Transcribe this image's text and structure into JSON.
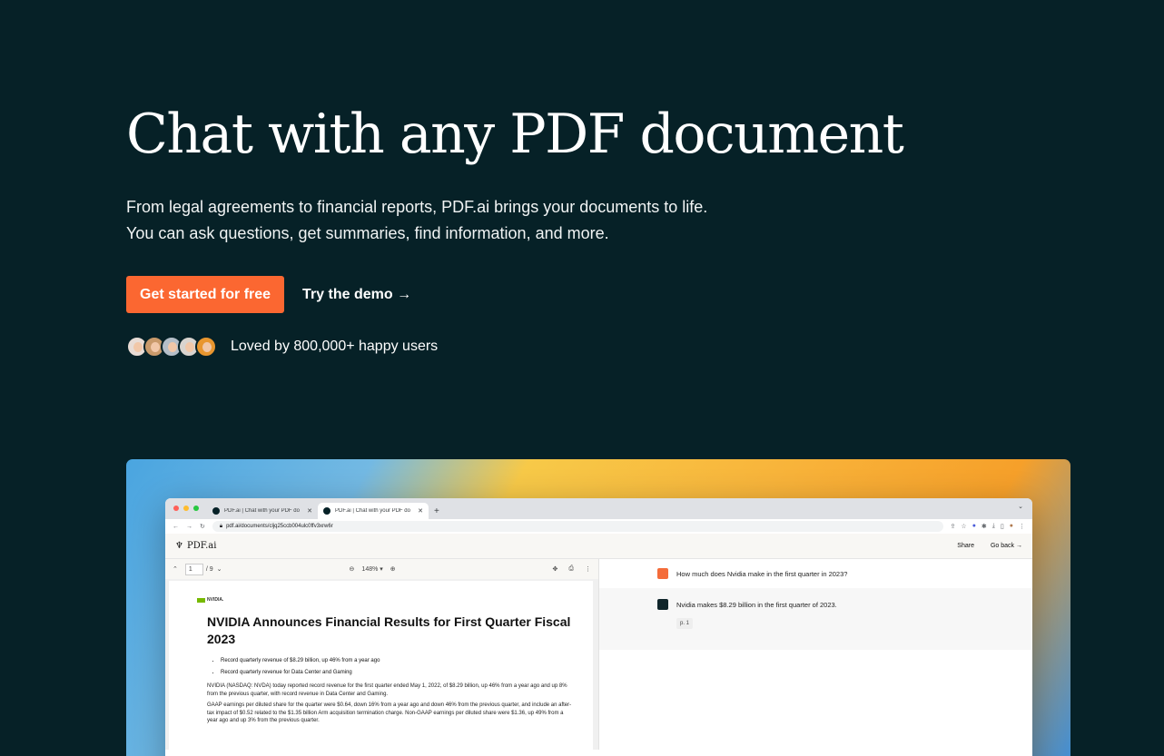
{
  "hero": {
    "title": "Chat with any PDF document",
    "subtitle_line1": "From legal agreements to financial reports, PDF.ai brings your documents to life.",
    "subtitle_line2": "You can ask questions, get summaries, find information, and more.",
    "primary_cta": "Get started for free",
    "secondary_cta": "Try the demo →",
    "social_proof": "Loved by 800,000+ happy users",
    "avatar_colors": [
      "#e8dcd5",
      "#c99a6b",
      "#b4bec8",
      "#d9d4cf",
      "#e8962f"
    ]
  },
  "colors": {
    "background": "#062127",
    "accent": "#fb6731"
  },
  "browser": {
    "tabs": [
      {
        "title": "PDF.ai | Chat with your PDF do"
      },
      {
        "title": "PDF.ai | Chat with your PDF do"
      }
    ],
    "new_tab": "+",
    "url": "pdf.ai/documents/cljq25ccb004ulc0ffv3xrw6r",
    "app_name": "PDF.ai",
    "share": "Share",
    "go_back": "Go back →"
  },
  "pdf_viewer": {
    "current_page": "1",
    "total_pages": "/ 9",
    "zoom": "148% ▾",
    "logo_text": "NVIDIA.",
    "doc_title": "NVIDIA Announces Financial Results for First Quarter Fiscal 2023",
    "bullets": [
      "Record quarterly revenue of $8.29 billion, up 46% from a year ago",
      "Record quarterly revenue for Data Center and Gaming"
    ],
    "paragraph1": "NVIDIA (NASDAQ: NVDA) today reported record revenue for the first quarter ended May 1, 2022, of $8.29 billion, up 46% from a year ago and up 8% from the previous quarter, with record revenue in Data Center and Gaming.",
    "paragraph2": "GAAP earnings per diluted share for the quarter were $0.64, down 16% from a year ago and down 46% from the previous quarter, and include an after-tax impact of $0.52 related to the $1.35 billion Arm acquisition termination charge. Non-GAAP earnings per diluted share were $1.36, up 49% from a year ago and up 3% from the previous quarter."
  },
  "chat": {
    "question": "How much does Nvidia make in the first quarter in 2023?",
    "answer": "Nvidia makes $8.29 billion in the first quarter of 2023.",
    "page_ref": "p. 1"
  }
}
